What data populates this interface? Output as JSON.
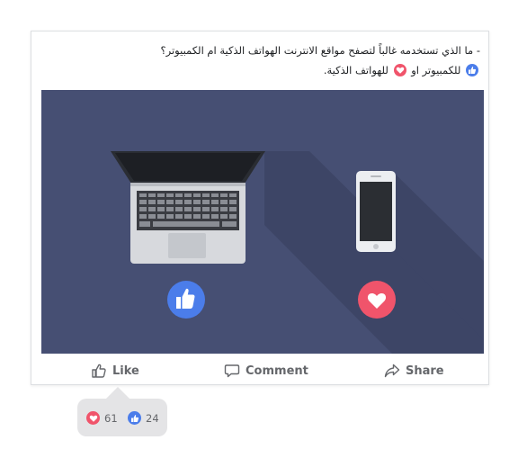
{
  "post": {
    "line1": "- ما الذي تستخدمه غالباً لتصفح مواقع الانترنت الهواتف الذكية ام الكمبيوتر؟",
    "line2_part1": "للكمبيوتر او",
    "line2_part2": "للهواتف الذكية."
  },
  "actions": {
    "like_label": "Like",
    "comment_label": "Comment",
    "share_label": "Share"
  },
  "reactions": {
    "love_count": "61",
    "like_count": "24"
  },
  "colors": {
    "like_blue": "#4b7dea",
    "love_red": "#f0546b",
    "media_bg": "#464f73"
  }
}
